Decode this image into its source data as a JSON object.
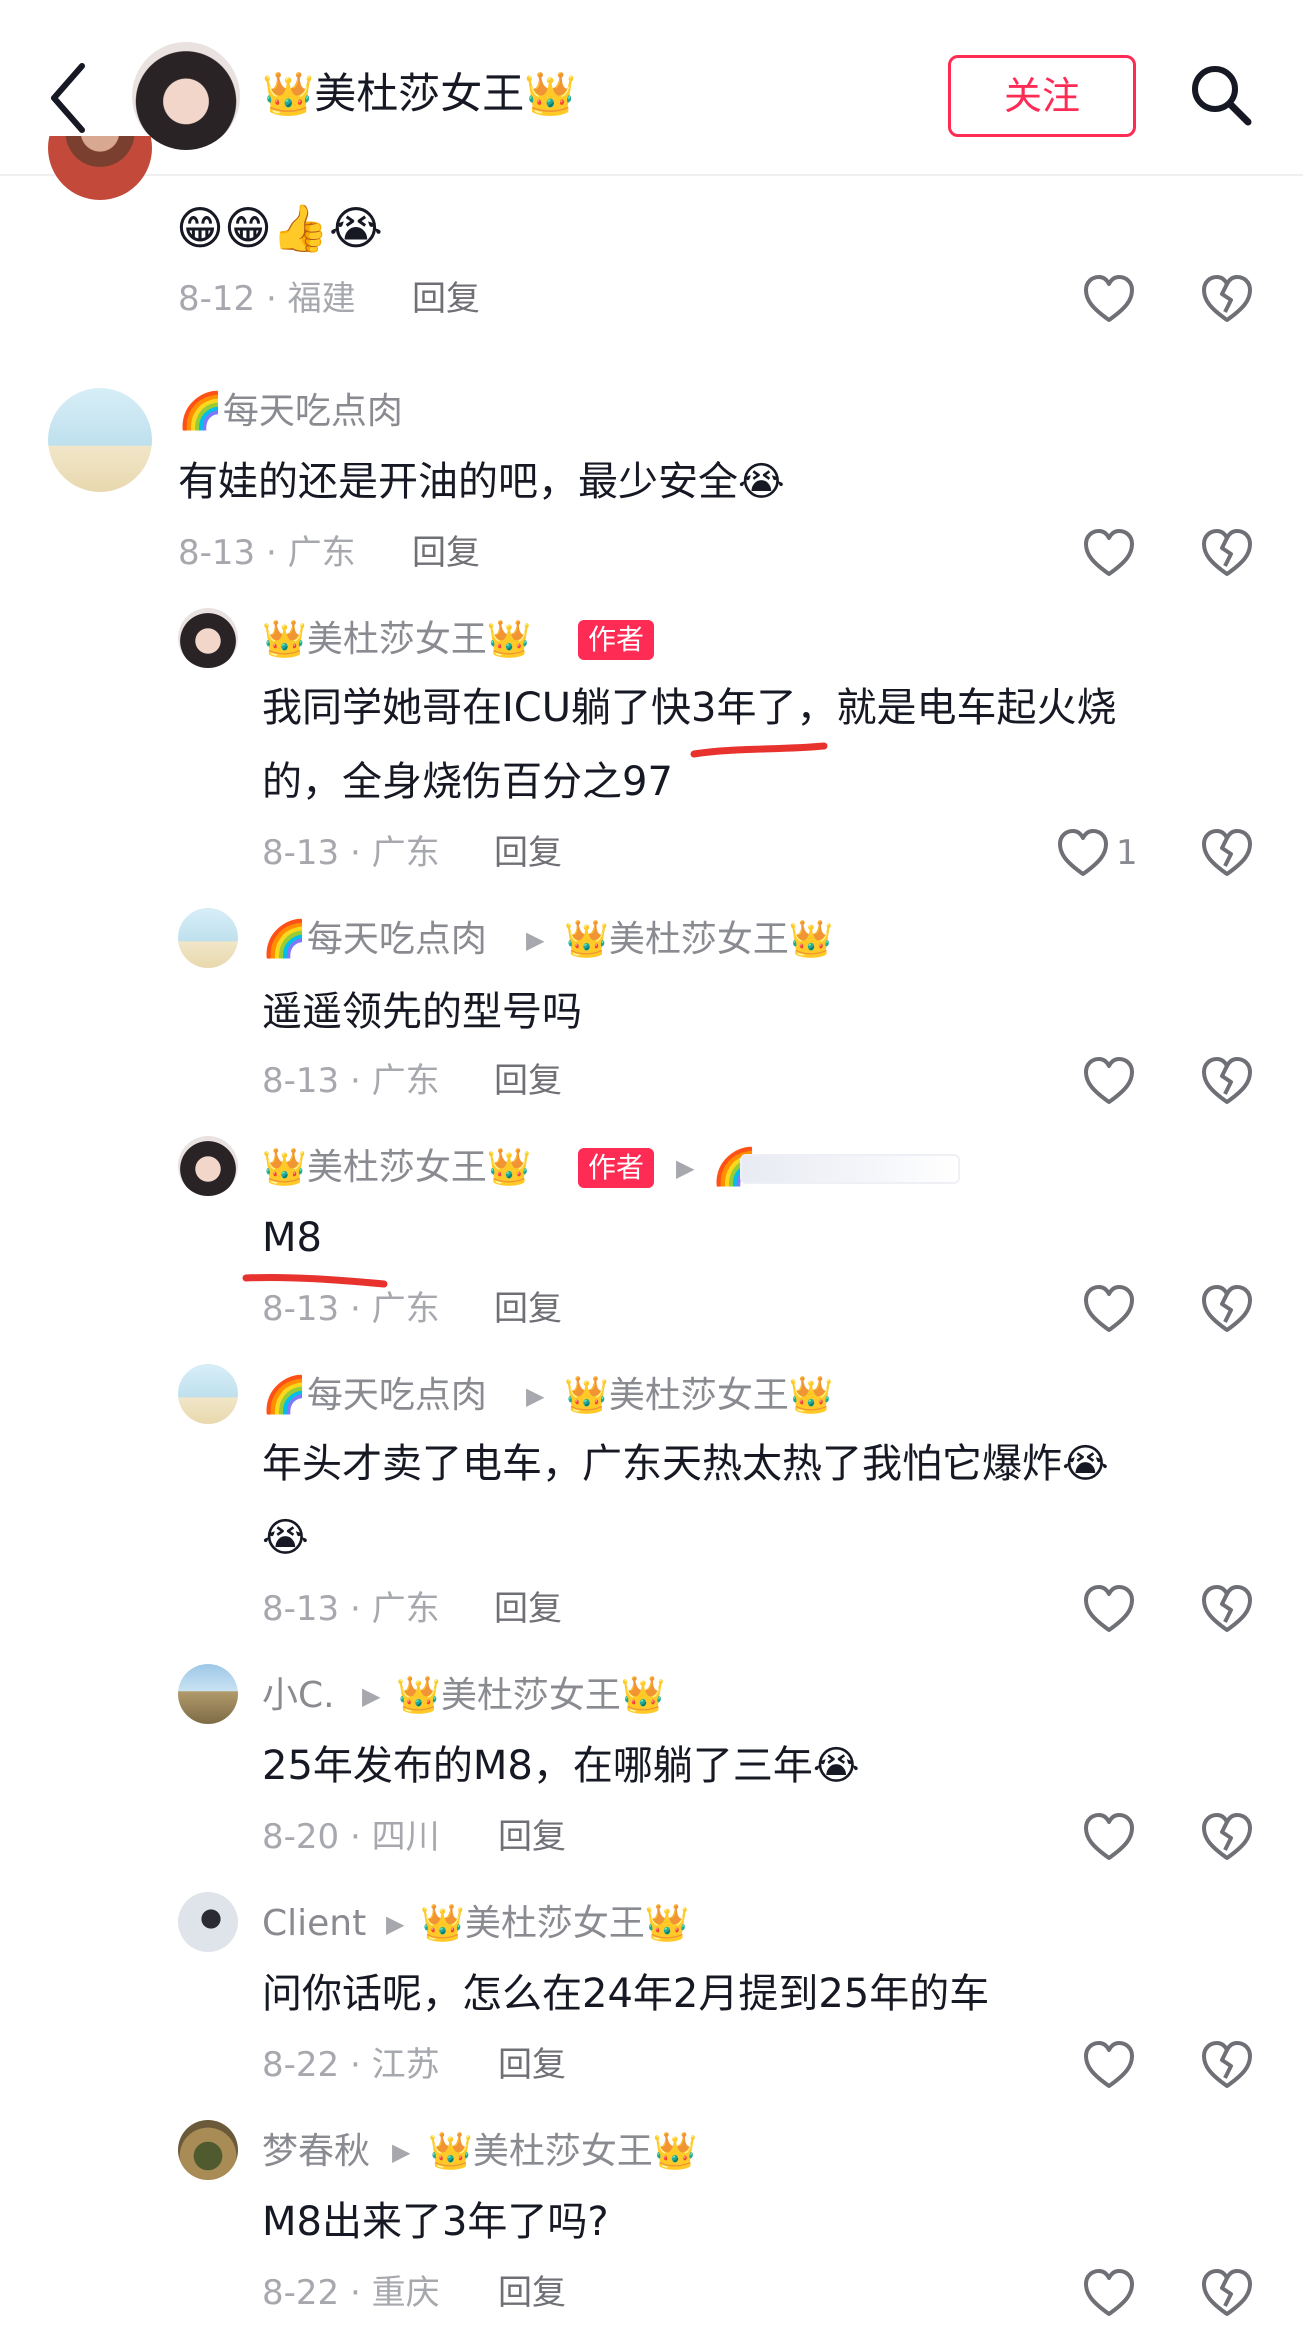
{
  "header": {
    "title": "👑美杜莎女王👑",
    "follow_label": "关注",
    "back_icon": "chevron-left-icon",
    "search_icon": "search-icon"
  },
  "colors": {
    "accent": "#fe2c55",
    "meta_gray": "#a7a8ae",
    "text": "#161823"
  },
  "comments": [
    {
      "emoji": "😁😁👍😭",
      "date": "8-12 · 福建",
      "reply": "回复"
    },
    {
      "user": "🌈每天吃点肉",
      "text": "有娃的还是开油的吧，最少安全😭",
      "date": "8-13 · 广东",
      "reply": "回复"
    },
    {
      "user": "👑美杜莎女王👑",
      "badge": "作者",
      "text_line1": "我同学她哥在ICU躺了快3年了，就是电车起火烧",
      "text_line2": "的，全身烧伤百分之97",
      "date": "8-13 · 广东",
      "reply": "回复",
      "like_count": "1"
    },
    {
      "user": "🌈每天吃点肉",
      "reply_to": "👑美杜莎女王👑",
      "text": "遥遥领先的型号吗",
      "date": "8-13 · 广东",
      "reply": "回复"
    },
    {
      "user": "👑美杜莎女王👑",
      "badge": "作者",
      "reply_to": "🌈",
      "text": "M8",
      "date": "8-13 · 广东",
      "reply": "回复"
    },
    {
      "user": "🌈每天吃点肉",
      "reply_to": "👑美杜莎女王👑",
      "text_line1": "年头才卖了电车，广东天热太热了我怕它爆炸😭",
      "text_line2": "😭",
      "date": "8-13 · 广东",
      "reply": "回复"
    },
    {
      "user": "小C.",
      "reply_to": "👑美杜莎女王👑",
      "text": "25年发布的M8，在哪躺了三年😭",
      "date": "8-20 · 四川",
      "reply": "回复"
    },
    {
      "user": "Client",
      "reply_to": "👑美杜莎女王👑",
      "text": "问你话呢，怎么在24年2月提到25年的车",
      "date": "8-22 · 江苏",
      "reply": "回复"
    },
    {
      "user": "梦春秋",
      "reply_to": "👑美杜莎女王👑",
      "text": "M8出来了3年了吗?",
      "date": "8-22 · 重庆",
      "reply": "回复"
    }
  ]
}
